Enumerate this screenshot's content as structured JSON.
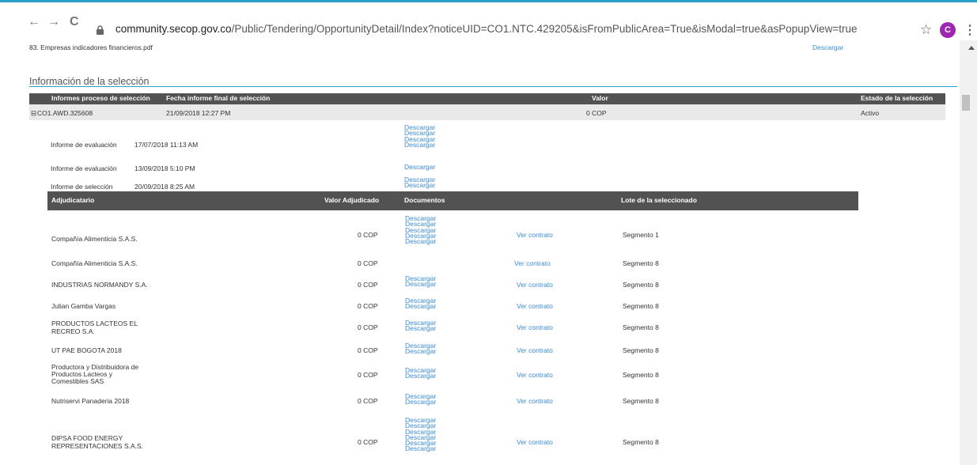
{
  "browser": {
    "back_icon": "←",
    "forward_icon": "→",
    "reload_icon": "C",
    "url_host": "community.secop.gov.co",
    "url_path": "/Public/Tendering/OpportunityDetail/Index?noticeUID=CO1.NTC.429205&isFromPublicArea=True&isModal=true&asPopupView=true",
    "star_icon": "☆",
    "profile_initial": "C",
    "menu_icon": "⋮"
  },
  "top_row": {
    "doc_name": "83. Empresas indicadores financieros.pdf",
    "download": "Descargar"
  },
  "section": {
    "title": "Información de la selección"
  },
  "main_table": {
    "headers": [
      "Informes proceso de selección",
      "Fecha informe final de selección",
      "Valor",
      "Estado de la selección"
    ],
    "award": {
      "id": "CO1.AWD.325608",
      "date": "21/09/2018 12:27 PM",
      "value": "0 COP",
      "status": "Activo"
    }
  },
  "reports": [
    {
      "name": "Informe de evaluación",
      "date": "17/07/2018 11:13 AM",
      "links": [
        "Descargar",
        "Descargar",
        "Descargar",
        "Descargar"
      ]
    },
    {
      "name": "Informe de evaluación",
      "date": "13/09/2018 5:10 PM",
      "links": [
        "Descargar"
      ]
    },
    {
      "name": "Informe de selección",
      "date": "20/09/2018 8:25 AM",
      "links": [
        "Descargar",
        "Descargar"
      ]
    }
  ],
  "sub_table": {
    "headers": [
      "Adjudicatario",
      "Valor Adjudicado",
      "Documentos",
      "Lote de la seleccionado"
    ],
    "rows": [
      {
        "name": [
          "Compañía Alimenticia S.A.S."
        ],
        "value": "0 COP",
        "docs": [
          "Descargar",
          "Descargar",
          "Descargar",
          "Descargar",
          "Descargar"
        ],
        "contract": "Ver contrato",
        "lot": "Segmento 1"
      },
      {
        "name": [
          "Compañía Alimenticia S.A.S."
        ],
        "value": "0 COP",
        "docs": [],
        "contract": "Ver contrato",
        "lot": "Segmento 8"
      },
      {
        "name": [
          "INDUSTRIAS NORMANDY S.A."
        ],
        "value": "0 COP",
        "docs": [
          "Descargar",
          "Descargar"
        ],
        "contract": "Ver contrato",
        "lot": "Segmento 8"
      },
      {
        "name": [
          "Julian Gamba Vargas"
        ],
        "value": "0 COP",
        "docs": [
          "Descargar",
          "Descargar"
        ],
        "contract": "Ver contrato",
        "lot": "Segmento 8"
      },
      {
        "name": [
          "PRODUCTOS LACTEOS EL",
          "RECREO S.A."
        ],
        "value": "0 COP",
        "docs": [
          "Descargar",
          "Descargar"
        ],
        "contract": "Ver contrato",
        "lot": "Segmento 8"
      },
      {
        "name": [
          "UT PAE BOGOTA 2018"
        ],
        "value": "0 COP",
        "docs": [
          "Descargar",
          "Descargar"
        ],
        "contract": "Ver contrato",
        "lot": "Segmento 8"
      },
      {
        "name": [
          "Productora y Distribuidora de",
          "Productos Lacteos y",
          "Comestibles SAS"
        ],
        "value": "0 COP",
        "docs": [
          "Descargar",
          "Descargar"
        ],
        "contract": "Ver contrato",
        "lot": "Segmento 8"
      },
      {
        "name": [
          "Nutriservi Panaderia 2018"
        ],
        "value": "0 COP",
        "docs": [
          "Descargar",
          "Descargar"
        ],
        "contract": "Ver contrato",
        "lot": "Segmento 8"
      },
      {
        "name": [
          "DIPSA FOOD ENERGY",
          "REPRESENTACIONES S.A.S."
        ],
        "value": "0 COP",
        "docs": [
          "Descargar",
          "Descargar",
          "Descargar",
          "Descargar",
          "Descargar",
          "Descargar"
        ],
        "contract": "Ver contrato",
        "lot": "Segmento 8"
      }
    ]
  }
}
